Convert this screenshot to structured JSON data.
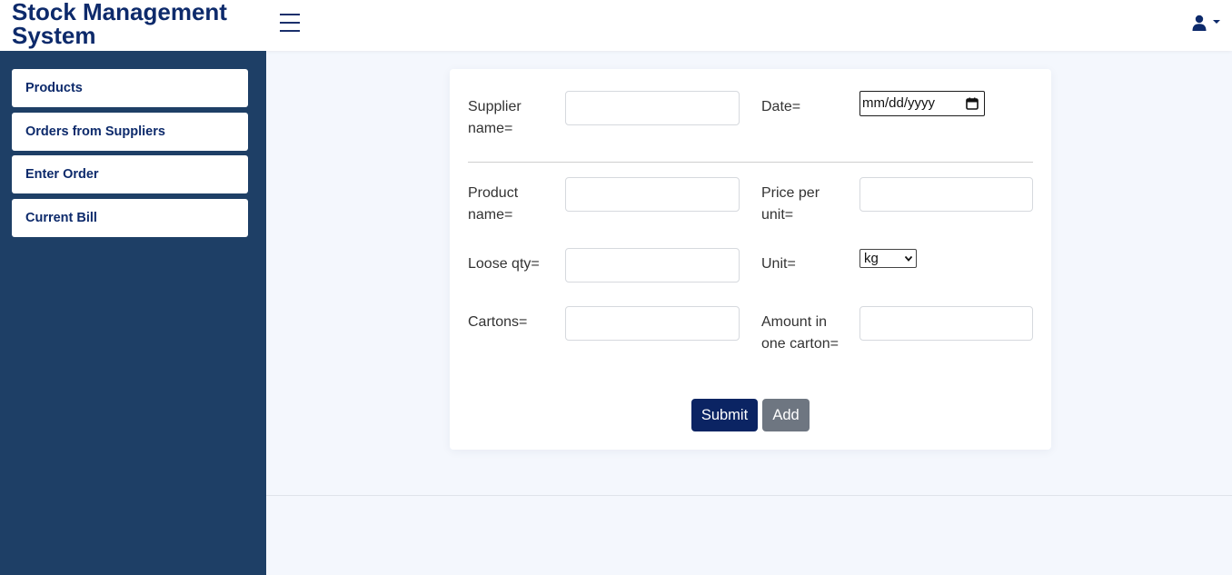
{
  "header": {
    "title": "Stock Management System",
    "menu_icon": "hamburger-icon",
    "user_icon": "user-icon"
  },
  "sidebar": {
    "items": [
      {
        "label": "Products"
      },
      {
        "label": "Orders from Suppliers"
      },
      {
        "label": "Enter Order"
      },
      {
        "label": "Current Bill"
      }
    ]
  },
  "form": {
    "supplier_name_label": "Supplier name=",
    "supplier_name_value": "",
    "date_label": "Date=",
    "date_placeholder": "mm/dd/yyyy",
    "product_name_label": "Product name=",
    "product_name_value": "",
    "price_per_unit_label": "Price per unit=",
    "price_per_unit_value": "",
    "loose_qty_label": "Loose qty=",
    "loose_qty_value": "",
    "unit_label": "Unit=",
    "unit_selected": "kg",
    "cartons_label": "Cartons=",
    "cartons_value": "",
    "amount_in_carton_label": "Amount in one carton=",
    "amount_in_carton_value": "",
    "submit_label": "Submit",
    "add_label": "Add"
  },
  "colors": {
    "brand": "#0d2a6b",
    "sidebar_bg": "#1e3f66",
    "page_bg": "#f4f7fd",
    "submit_bg": "#0b2463",
    "add_bg": "#6e7681"
  }
}
